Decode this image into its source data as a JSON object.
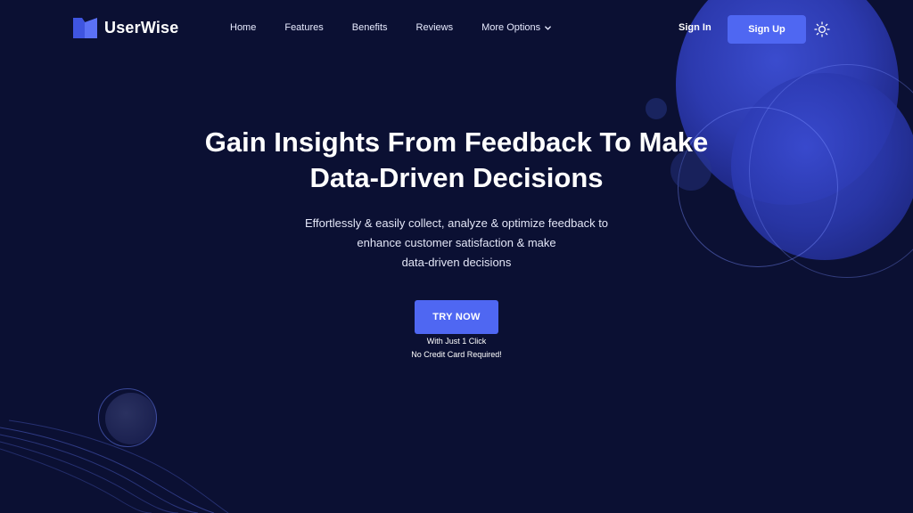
{
  "brand": {
    "name": "UserWise",
    "logo_icon": "userwise-logo-icon",
    "accent": "#4f67f2"
  },
  "nav": {
    "items": [
      {
        "label": "Home"
      },
      {
        "label": "Features"
      },
      {
        "label": "Benefits"
      },
      {
        "label": "Reviews"
      },
      {
        "label": "More Options",
        "icon": "chevron-down-icon"
      }
    ],
    "sign_in": "Sign In",
    "sign_up": "Sign Up",
    "theme_icon": "sun-icon"
  },
  "hero": {
    "title_lines": [
      "Gain Insights From Feedback To Make",
      "Data-Driven Decisions"
    ],
    "subtitle_lines": [
      "Effortlessly & easily collect, analyze & optimize feedback to",
      "enhance customer satisfaction & make",
      "data-driven decisions"
    ],
    "cta_label": "TRY NOW",
    "cta_notes": [
      "With Just 1 Click",
      "No Credit Card Required!"
    ]
  },
  "colors": {
    "background": "#0b1033",
    "button": "#4f67f2",
    "orb": "#3d4fd6"
  }
}
